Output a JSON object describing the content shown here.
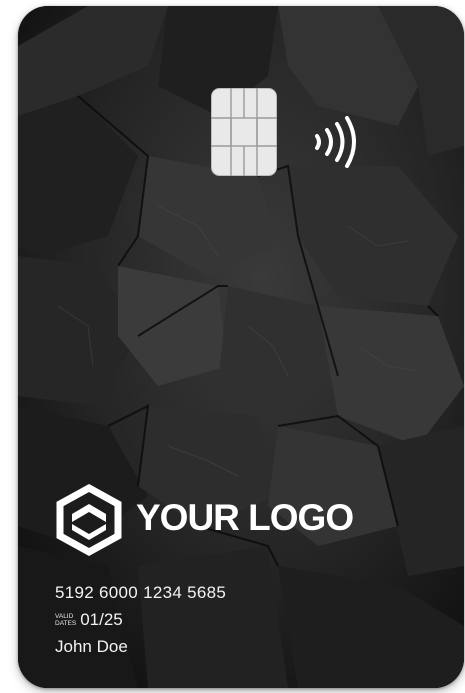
{
  "card": {
    "logo_text": "YOUR LOGO",
    "number": "5192 6000 1234 5685",
    "valid_label_line1": "VALID",
    "valid_label_line2": "DATES",
    "valid_date": "01/25",
    "holder_name": "John Doe"
  },
  "icons": {
    "chip": "chip-icon",
    "contactless": "contactless-icon",
    "logo_mark": "hexagon-logo-icon"
  },
  "colors": {
    "card_background": "#1b1b1b",
    "text": "#ffffff",
    "chip": "#e9e9e9"
  }
}
